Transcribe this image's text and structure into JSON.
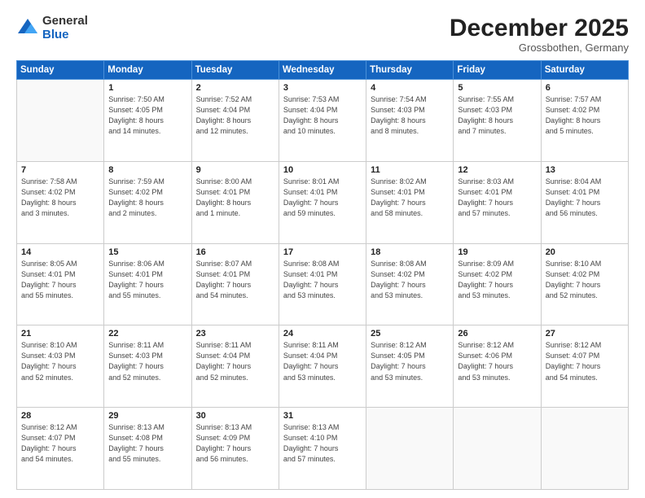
{
  "logo": {
    "general": "General",
    "blue": "Blue"
  },
  "header": {
    "month": "December 2025",
    "location": "Grossbothen, Germany"
  },
  "days_of_week": [
    "Sunday",
    "Monday",
    "Tuesday",
    "Wednesday",
    "Thursday",
    "Friday",
    "Saturday"
  ],
  "weeks": [
    [
      {
        "day": null,
        "info": null
      },
      {
        "day": "1",
        "info": "Sunrise: 7:50 AM\nSunset: 4:05 PM\nDaylight: 8 hours\nand 14 minutes."
      },
      {
        "day": "2",
        "info": "Sunrise: 7:52 AM\nSunset: 4:04 PM\nDaylight: 8 hours\nand 12 minutes."
      },
      {
        "day": "3",
        "info": "Sunrise: 7:53 AM\nSunset: 4:04 PM\nDaylight: 8 hours\nand 10 minutes."
      },
      {
        "day": "4",
        "info": "Sunrise: 7:54 AM\nSunset: 4:03 PM\nDaylight: 8 hours\nand 8 minutes."
      },
      {
        "day": "5",
        "info": "Sunrise: 7:55 AM\nSunset: 4:03 PM\nDaylight: 8 hours\nand 7 minutes."
      },
      {
        "day": "6",
        "info": "Sunrise: 7:57 AM\nSunset: 4:02 PM\nDaylight: 8 hours\nand 5 minutes."
      }
    ],
    [
      {
        "day": "7",
        "info": "Sunrise: 7:58 AM\nSunset: 4:02 PM\nDaylight: 8 hours\nand 3 minutes."
      },
      {
        "day": "8",
        "info": "Sunrise: 7:59 AM\nSunset: 4:02 PM\nDaylight: 8 hours\nand 2 minutes."
      },
      {
        "day": "9",
        "info": "Sunrise: 8:00 AM\nSunset: 4:01 PM\nDaylight: 8 hours\nand 1 minute."
      },
      {
        "day": "10",
        "info": "Sunrise: 8:01 AM\nSunset: 4:01 PM\nDaylight: 7 hours\nand 59 minutes."
      },
      {
        "day": "11",
        "info": "Sunrise: 8:02 AM\nSunset: 4:01 PM\nDaylight: 7 hours\nand 58 minutes."
      },
      {
        "day": "12",
        "info": "Sunrise: 8:03 AM\nSunset: 4:01 PM\nDaylight: 7 hours\nand 57 minutes."
      },
      {
        "day": "13",
        "info": "Sunrise: 8:04 AM\nSunset: 4:01 PM\nDaylight: 7 hours\nand 56 minutes."
      }
    ],
    [
      {
        "day": "14",
        "info": "Sunrise: 8:05 AM\nSunset: 4:01 PM\nDaylight: 7 hours\nand 55 minutes."
      },
      {
        "day": "15",
        "info": "Sunrise: 8:06 AM\nSunset: 4:01 PM\nDaylight: 7 hours\nand 55 minutes."
      },
      {
        "day": "16",
        "info": "Sunrise: 8:07 AM\nSunset: 4:01 PM\nDaylight: 7 hours\nand 54 minutes."
      },
      {
        "day": "17",
        "info": "Sunrise: 8:08 AM\nSunset: 4:01 PM\nDaylight: 7 hours\nand 53 minutes."
      },
      {
        "day": "18",
        "info": "Sunrise: 8:08 AM\nSunset: 4:02 PM\nDaylight: 7 hours\nand 53 minutes."
      },
      {
        "day": "19",
        "info": "Sunrise: 8:09 AM\nSunset: 4:02 PM\nDaylight: 7 hours\nand 53 minutes."
      },
      {
        "day": "20",
        "info": "Sunrise: 8:10 AM\nSunset: 4:02 PM\nDaylight: 7 hours\nand 52 minutes."
      }
    ],
    [
      {
        "day": "21",
        "info": "Sunrise: 8:10 AM\nSunset: 4:03 PM\nDaylight: 7 hours\nand 52 minutes."
      },
      {
        "day": "22",
        "info": "Sunrise: 8:11 AM\nSunset: 4:03 PM\nDaylight: 7 hours\nand 52 minutes."
      },
      {
        "day": "23",
        "info": "Sunrise: 8:11 AM\nSunset: 4:04 PM\nDaylight: 7 hours\nand 52 minutes."
      },
      {
        "day": "24",
        "info": "Sunrise: 8:11 AM\nSunset: 4:04 PM\nDaylight: 7 hours\nand 53 minutes."
      },
      {
        "day": "25",
        "info": "Sunrise: 8:12 AM\nSunset: 4:05 PM\nDaylight: 7 hours\nand 53 minutes."
      },
      {
        "day": "26",
        "info": "Sunrise: 8:12 AM\nSunset: 4:06 PM\nDaylight: 7 hours\nand 53 minutes."
      },
      {
        "day": "27",
        "info": "Sunrise: 8:12 AM\nSunset: 4:07 PM\nDaylight: 7 hours\nand 54 minutes."
      }
    ],
    [
      {
        "day": "28",
        "info": "Sunrise: 8:12 AM\nSunset: 4:07 PM\nDaylight: 7 hours\nand 54 minutes."
      },
      {
        "day": "29",
        "info": "Sunrise: 8:13 AM\nSunset: 4:08 PM\nDaylight: 7 hours\nand 55 minutes."
      },
      {
        "day": "30",
        "info": "Sunrise: 8:13 AM\nSunset: 4:09 PM\nDaylight: 7 hours\nand 56 minutes."
      },
      {
        "day": "31",
        "info": "Sunrise: 8:13 AM\nSunset: 4:10 PM\nDaylight: 7 hours\nand 57 minutes."
      },
      {
        "day": null,
        "info": null
      },
      {
        "day": null,
        "info": null
      },
      {
        "day": null,
        "info": null
      }
    ]
  ]
}
